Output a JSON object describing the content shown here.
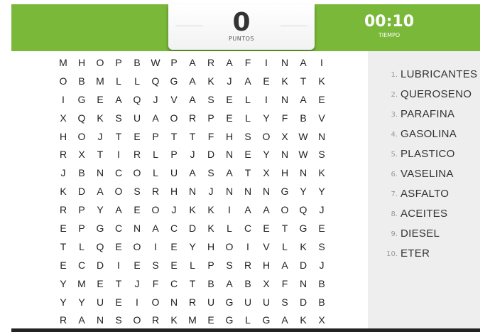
{
  "score": {
    "value": "0",
    "label": "PUNTOS"
  },
  "timer": {
    "value": "00:10",
    "label": "TIEMPO"
  },
  "grid": [
    "MHOPBWPARAFINAI",
    "OBMLLQGAKJAEKTK",
    "IGEAQJVASELINAE",
    "XQKSUAORPELYFBV",
    "HOJTEPTTFHSOXWN",
    "RXTIRLPJDNEYNWS",
    "JBNCOLUASATXHNK",
    "KDAOSRHNJNNNGYY",
    "RPYAEOJKKIAAOQJ",
    "EPGCNACDKLCETGE",
    "TLQEOIEYHOIVLKS",
    "ECDIESELPSRHADJ",
    "YMETJFCTBABXFNB",
    "YYUEIONRUGUUSDB",
    "RANSORKMEGLGAKX"
  ],
  "words": [
    {
      "num": "1.",
      "text": "LUBRICANTES"
    },
    {
      "num": "2.",
      "text": "QUEROSENO"
    },
    {
      "num": "3.",
      "text": "PARAFINA"
    },
    {
      "num": "4.",
      "text": "GASOLINA"
    },
    {
      "num": "5.",
      "text": "PLASTICO"
    },
    {
      "num": "6.",
      "text": "VASELINA"
    },
    {
      "num": "7.",
      "text": "ASFALTO"
    },
    {
      "num": "8.",
      "text": "ACEITES"
    },
    {
      "num": "9.",
      "text": "DIESEL"
    },
    {
      "num": "10.",
      "text": "ETER"
    }
  ],
  "colors": {
    "header": "#7ab83a",
    "panel": "#eeeeee"
  }
}
